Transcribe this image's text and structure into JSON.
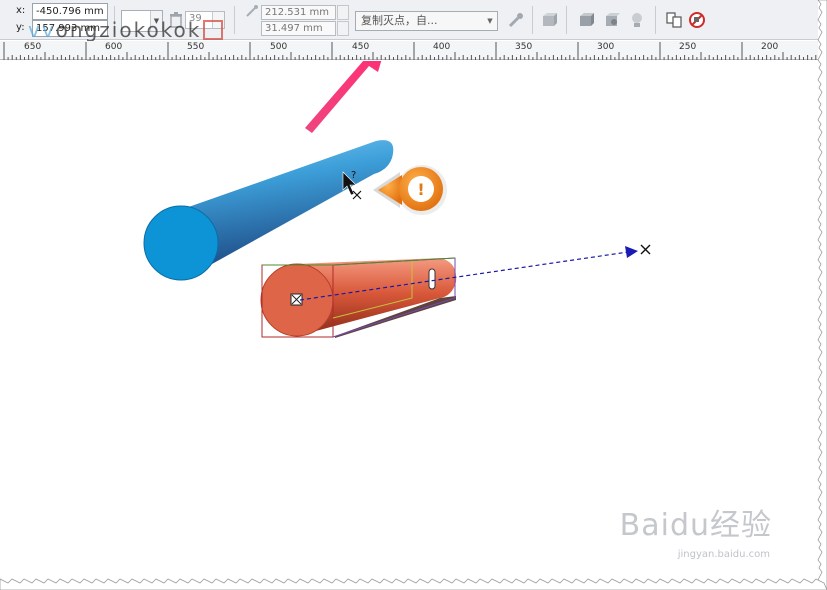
{
  "toolbar": {
    "x_label": "x:",
    "x_value": "-450.796 mm",
    "y_label": "y:",
    "y_value": "157.993 mm",
    "depth_value": "39",
    "width_value": "212.531 mm",
    "height_value": "31.497 mm",
    "vanishing_combo": "复制灭点，自..."
  },
  "watermark": {
    "text_v": "vv",
    "text_rest": "ongziokokok"
  },
  "ruler": {
    "labels": [
      "650",
      "600",
      "550",
      "500",
      "450",
      "400",
      "350",
      "300",
      "250",
      "200"
    ]
  },
  "canvas": {
    "cursor_hint": "?",
    "alert_symbol": "!"
  },
  "footer_watermark": {
    "brand": "Baidu经验",
    "url": "jingyan.baidu.com"
  },
  "colors": {
    "blue_cylinder": "#2f8fd0",
    "red_cylinder": "#d95b3d",
    "arrow_pink": "#f0327a",
    "alert_orange": "#ef8a22"
  }
}
